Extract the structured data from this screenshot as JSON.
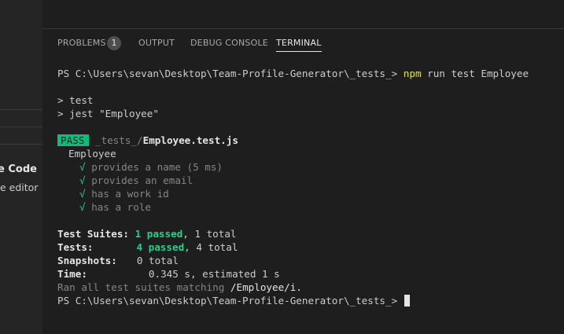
{
  "sidebar": {
    "fragment_title": "e Code",
    "fragment_subtitle": "e editor"
  },
  "panel": {
    "tabs": [
      {
        "label": "PROBLEMS",
        "badge": "1",
        "active": false
      },
      {
        "label": "OUTPUT",
        "active": false
      },
      {
        "label": "DEBUG CONSOLE",
        "active": false
      },
      {
        "label": "TERMINAL",
        "active": true
      }
    ]
  },
  "terminal": {
    "prompt": "PS C:\\Users\\sevan\\Desktop\\Team-Profile-Generator\\_tests_>",
    "command_bin": "npm",
    "command_args": "run test Employee",
    "script_lines": [
      "> test",
      "> jest \"Employee\""
    ],
    "pass_label": "PASS",
    "test_dir": "_tests_/",
    "test_file": "Employee.test.js",
    "suite_name": "Employee",
    "check_glyph": "√",
    "tests": [
      {
        "name": "provides a name (5 ms)"
      },
      {
        "name": "provides an email"
      },
      {
        "name": "has a work id"
      },
      {
        "name": "has a role"
      }
    ],
    "summary": {
      "suites_label": "Test Suites:",
      "suites_passed": "1 passed",
      "suites_total": ", 1 total",
      "tests_label": "Tests:",
      "tests_passed": "4 passed",
      "tests_total": ", 4 total",
      "snapshots_label": "Snapshots:",
      "snapshots_value": "0 total",
      "time_label": "Time:",
      "time_value": "0.345 s, estimated 1 s"
    },
    "ran_all_prefix": "Ran all test suites matching",
    "ran_all_pattern": "/Employee/i."
  },
  "colors": {
    "background": "#1e1e1e",
    "pass_badge": "#0dbc79",
    "green_text": "#23d18b",
    "yellow_text": "#e5e510"
  }
}
